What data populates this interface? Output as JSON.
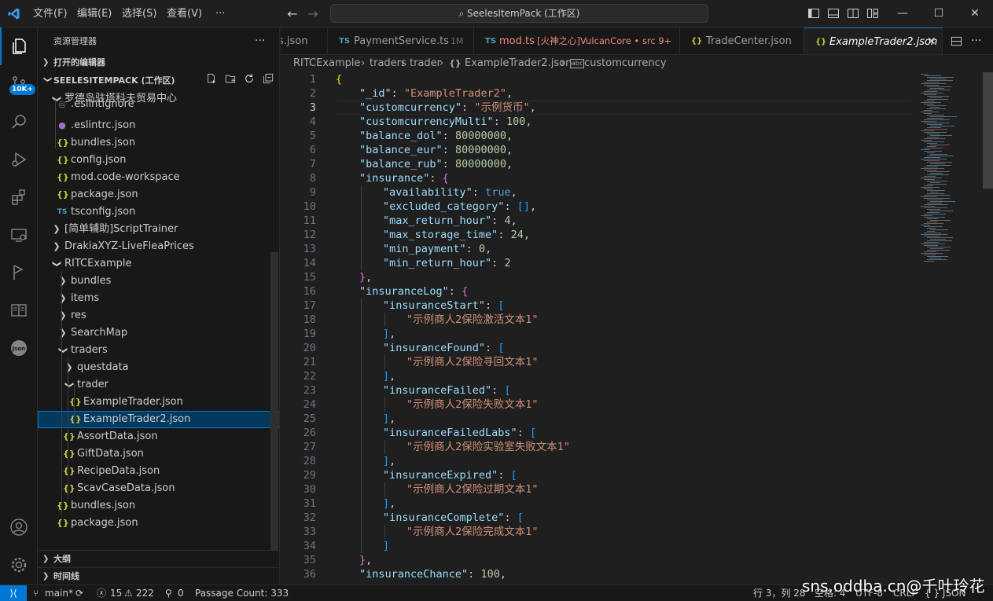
{
  "titlebar": {
    "menus": [
      "文件(F)",
      "编辑(E)",
      "选择(S)",
      "查看(V)",
      "···"
    ],
    "search_text": "SeelesItemPack (工作区)",
    "back_icon": "arrow-left-icon",
    "forward_icon": "arrow-right-icon"
  },
  "activity": {
    "badge": "10K+"
  },
  "sidebar": {
    "title": "资源管理器",
    "more": "···",
    "open_editors": "打开的编辑器",
    "workspace": "SEELESITEMPACK (工作区)",
    "tree": [
      {
        "label": "罗德岛驻塔科夫贸易中心",
        "depth": 1,
        "kind": "folder-open"
      },
      {
        "label": ".eslintignore",
        "depth": 2,
        "kind": "file"
      },
      {
        "label": ".eslintrc.json",
        "depth": 2,
        "kind": "eslint"
      },
      {
        "label": "bundles.json",
        "depth": 2,
        "kind": "json"
      },
      {
        "label": "config.json",
        "depth": 2,
        "kind": "json"
      },
      {
        "label": "mod.code-workspace",
        "depth": 2,
        "kind": "json"
      },
      {
        "label": "package.json",
        "depth": 2,
        "kind": "json"
      },
      {
        "label": "tsconfig.json",
        "depth": 2,
        "kind": "ts"
      },
      {
        "label": "[简单辅助]ScriptTrainer",
        "depth": 1,
        "kind": "folder"
      },
      {
        "label": "DrakiaXYZ-LiveFleaPrices",
        "depth": 1,
        "kind": "folder"
      },
      {
        "label": "RITCExample",
        "depth": 1,
        "kind": "folder-open"
      },
      {
        "label": "bundles",
        "depth": 2,
        "kind": "folder"
      },
      {
        "label": "items",
        "depth": 2,
        "kind": "folder"
      },
      {
        "label": "res",
        "depth": 2,
        "kind": "folder"
      },
      {
        "label": "SearchMap",
        "depth": 2,
        "kind": "folder"
      },
      {
        "label": "traders",
        "depth": 2,
        "kind": "folder-open"
      },
      {
        "label": "questdata",
        "depth": 3,
        "kind": "folder"
      },
      {
        "label": "trader",
        "depth": 3,
        "kind": "folder-open"
      },
      {
        "label": "ExampleTrader.json",
        "depth": 4,
        "kind": "json"
      },
      {
        "label": "ExampleTrader2.json",
        "depth": 4,
        "kind": "json",
        "selected": true
      },
      {
        "label": "AssortData.json",
        "depth": 3,
        "kind": "json"
      },
      {
        "label": "GiftData.json",
        "depth": 3,
        "kind": "json"
      },
      {
        "label": "RecipeData.json",
        "depth": 3,
        "kind": "json"
      },
      {
        "label": "ScavCaseData.json",
        "depth": 3,
        "kind": "json"
      },
      {
        "label": "bundles.json",
        "depth": 2,
        "kind": "json"
      },
      {
        "label": "package.json",
        "depth": 2,
        "kind": "json"
      }
    ],
    "outline": "大纲",
    "timeline": "时间线"
  },
  "tabs": [
    {
      "icon": "",
      "label": "s.json",
      "extra": ""
    },
    {
      "icon": "TS",
      "label": "PaymentService.ts",
      "extra": "1M"
    },
    {
      "icon": "TS",
      "label": "mod.ts",
      "extra": "[火神之心]VulcanCore • src 9+"
    },
    {
      "icon": "{}",
      "label": "TradeCenter.json",
      "extra": ""
    },
    {
      "icon": "{}",
      "label": "ExampleTrader2.json",
      "extra": "",
      "active": true
    }
  ],
  "breadcrumb": [
    "RITCExample",
    "traders",
    "trader",
    "ExampleTrader2.json",
    "customcurrency"
  ],
  "editor": {
    "current_line": 3,
    "lines": [
      "{",
      "\"_id\": \"ExampleTrader2\",",
      "\"customcurrency\": \"示例货币\",",
      "\"customcurrencyMulti\": 100,",
      "\"balance_dol\": 80000000,",
      "\"balance_eur\": 80000000,",
      "\"balance_rub\": 80000000,",
      "\"insurance\": {",
      "\"availability\": true,",
      "\"excluded_category\": [],",
      "\"max_return_hour\": 4,",
      "\"max_storage_time\": 24,",
      "\"min_payment\": 0,",
      "\"min_return_hour\": 2",
      "},",
      "\"insuranceLog\": {",
      "\"insuranceStart\": [",
      "\"示例商人2保险激活文本1\"",
      "],",
      "\"insuranceFound\": [",
      "\"示例商人2保险寻回文本1\"",
      "],",
      "\"insuranceFailed\": [",
      "\"示例商人2保险失败文本1\"",
      "],",
      "\"insuranceFailedLabs\": [",
      "\"示例商人2保险实验室失败文本1\"",
      "],",
      "\"insuranceExpired\": [",
      "\"示例商人2保险过期文本1\"",
      "],",
      "\"insuranceComplete\": [",
      "\"示例商人2保险完成文本1\"",
      "]",
      "},",
      "\"insuranceChance\": 100,"
    ]
  },
  "status": {
    "branch": "main*",
    "errors": "15",
    "warnings": "222",
    "ports": "0",
    "passage": "Passage Count: 333",
    "position": "行 3，列 28",
    "spaces": "空格: 4",
    "encoding": "UTF-8",
    "eol": "CRLF",
    "language": "{ } JSON"
  },
  "watermark": "sns.oddba.cn@千叶玲花",
  "colors": {
    "accent": "#0078d4",
    "json_icon": "#cbcb41",
    "ts_icon": "#519aba"
  }
}
